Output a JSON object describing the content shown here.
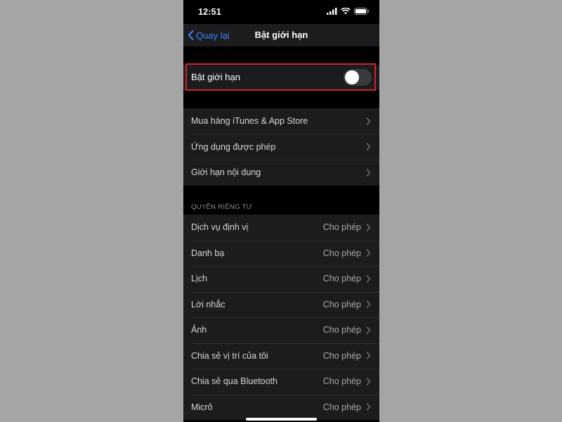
{
  "status_bar": {
    "time": "12:51"
  },
  "nav": {
    "back_label": "Quay lại",
    "title": "Bật giới hạn"
  },
  "restriction_toggle": {
    "label": "Bật giới hạn",
    "on": false
  },
  "content_group": [
    {
      "label": "Mua hàng iTunes & App Store"
    },
    {
      "label": "Ứng dụng được phép"
    },
    {
      "label": "Giới hạn nội dung"
    }
  ],
  "privacy": {
    "header": "QUYỀN RIÊNG TƯ",
    "items": [
      {
        "label": "Dịch vụ định vị",
        "value": "Cho phép"
      },
      {
        "label": "Danh bạ",
        "value": "Cho phép"
      },
      {
        "label": "Lịch",
        "value": "Cho phép"
      },
      {
        "label": "Lời nhắc",
        "value": "Cho phép"
      },
      {
        "label": "Ảnh",
        "value": "Cho phép"
      },
      {
        "label": "Chia sẻ vị trí của tôi",
        "value": "Cho phép"
      },
      {
        "label": "Chia sẻ qua Bluetooth",
        "value": "Cho phép"
      },
      {
        "label": "Micrô",
        "value": "Cho phép"
      }
    ]
  },
  "colors": {
    "accent": "#3b82f6",
    "highlight": "#d0242c"
  },
  "icons": [
    "signal-icon",
    "wifi-icon",
    "battery-icon",
    "chevron-left-icon",
    "chevron-right-icon"
  ]
}
